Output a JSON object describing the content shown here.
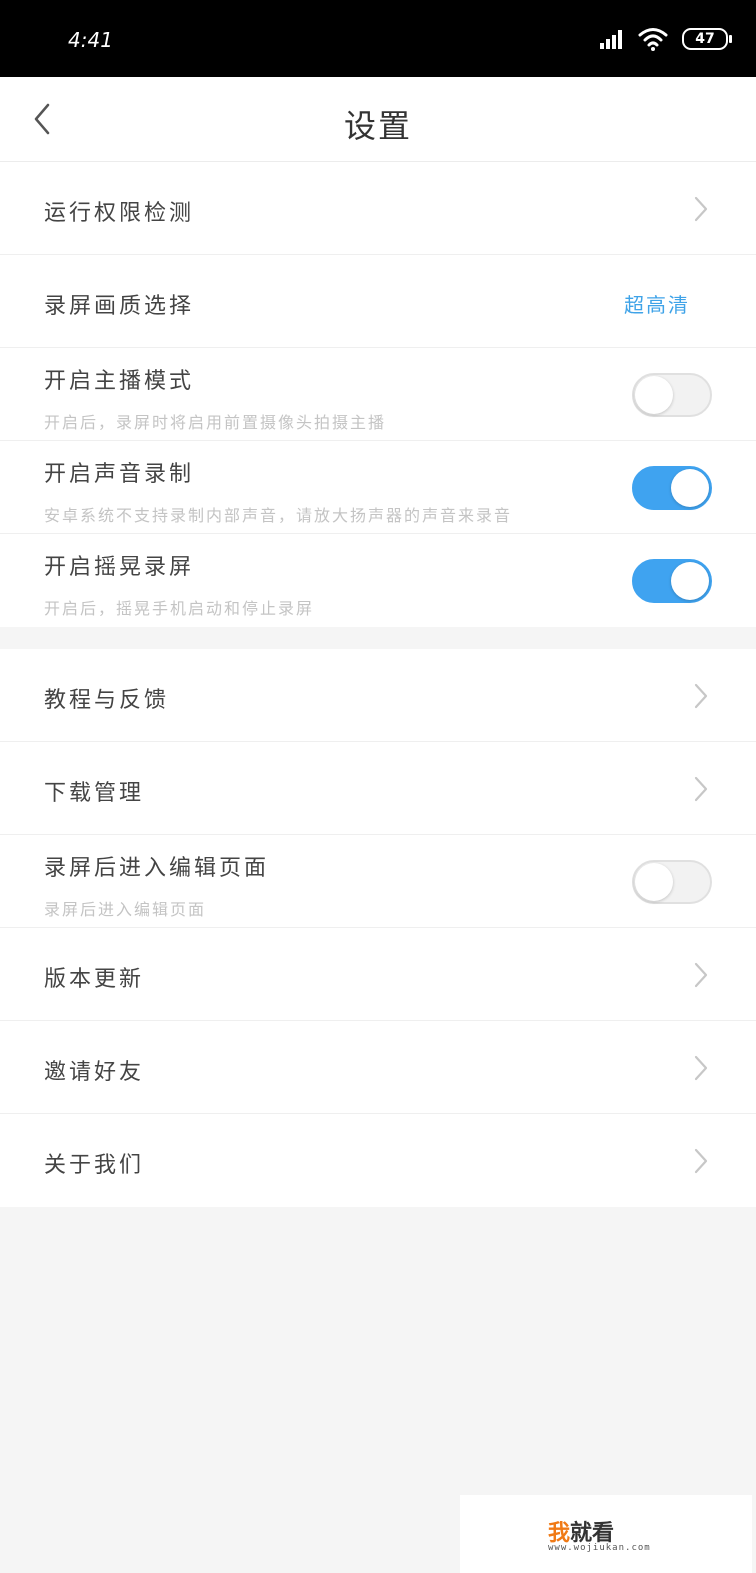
{
  "status_bar": {
    "time": "4:41",
    "battery": "47"
  },
  "header": {
    "title": "设置"
  },
  "group1": [
    {
      "title": "运行权限检测",
      "kind": "chevron"
    },
    {
      "title": "录屏画质选择",
      "kind": "value",
      "value": "超高清"
    },
    {
      "title": "开启主播模式",
      "subtitle": "开启后，录屏时将启用前置摄像头拍摄主播",
      "kind": "toggle",
      "on": false
    },
    {
      "title": "开启声音录制",
      "subtitle": "安卓系统不支持录制内部声音，请放大扬声器的声音来录音",
      "kind": "toggle",
      "on": true
    },
    {
      "title": "开启摇晃录屏",
      "subtitle": "开启后，摇晃手机启动和停止录屏",
      "kind": "toggle",
      "on": true
    }
  ],
  "group2": [
    {
      "title": "教程与反馈",
      "kind": "chevron"
    },
    {
      "title": "下载管理",
      "kind": "chevron"
    },
    {
      "title": "录屏后进入编辑页面",
      "subtitle": "录屏后进入编辑页面",
      "kind": "toggle",
      "on": false
    },
    {
      "title": "版本更新",
      "kind": "chevron"
    },
    {
      "title": "邀请好友",
      "kind": "chevron"
    },
    {
      "title": "关于我们",
      "kind": "chevron"
    }
  ],
  "watermark": {
    "brand_orange": "我",
    "brand_rest": "就看",
    "url": "www.wojiukan.com"
  },
  "colors": {
    "accent": "#3fa3f0",
    "value_text": "#3fa3e8",
    "brand": "#f07a16"
  },
  "icons": {
    "back": "chevron-left-icon",
    "row_arrow": "chevron-right-icon"
  }
}
